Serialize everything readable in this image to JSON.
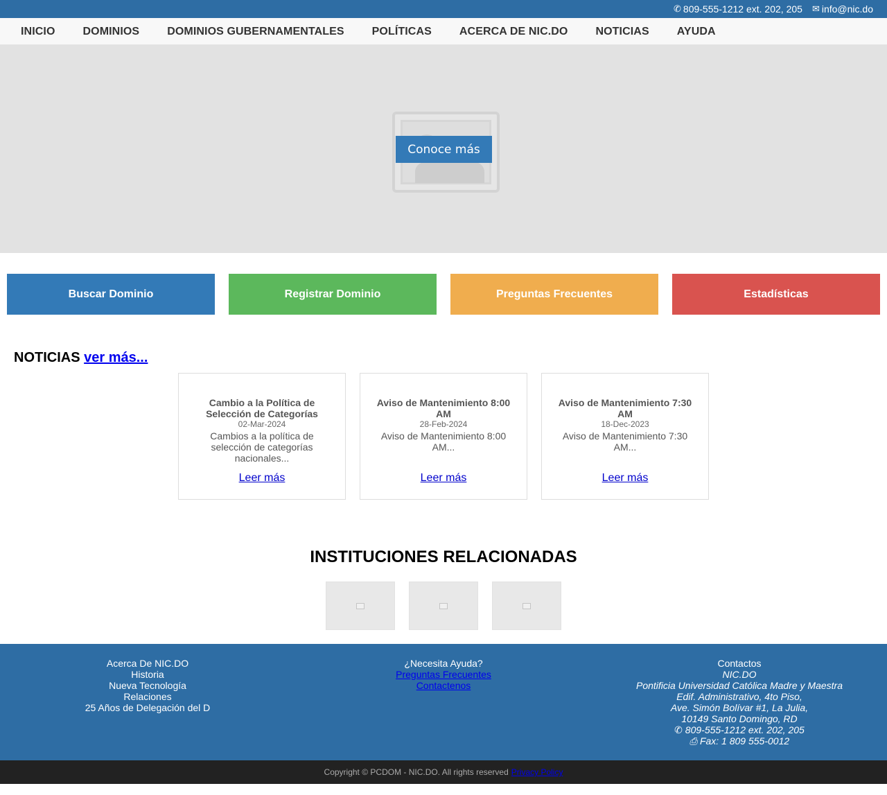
{
  "topbar": {
    "phone": "809-555-1212 ext. 202, 205",
    "email": "info@nic.do",
    "phone_icon": "phone-icon",
    "email_icon": "envelope-icon"
  },
  "nav": {
    "items": [
      "INICIO",
      "DOMINIOS",
      "DOMINIOS GUBERNAMENTALES",
      "POLÍTICAS",
      "ACERCA DE NIC.DO",
      "NOTICIAS",
      "AYUDA"
    ]
  },
  "hero": {
    "cta_label": "Conoce más",
    "image_icon": "image-placeholder-icon"
  },
  "tiles": [
    {
      "label": "Buscar Dominio",
      "color": "#337ab7"
    },
    {
      "label": "Registrar Dominio",
      "color": "#5cb85c"
    },
    {
      "label": "Preguntas Frecuentes",
      "color": "#f0ad4e"
    },
    {
      "label": "Estadísticas",
      "color": "#d9534f"
    }
  ],
  "news": {
    "heading": "NOTICIAS",
    "more_link": "ver más...",
    "cards": [
      {
        "title": "Cambio a la Política de Selección de Categorías",
        "date": "02-Mar-2024",
        "summary": "Cambios a la política de selección de categorías nacionales...",
        "link": "Leer más"
      },
      {
        "title": "Aviso de Mantenimiento 8:00 AM",
        "date": "28-Feb-2024",
        "summary": "Aviso de Mantenimiento 8:00 AM...",
        "link": "Leer más"
      },
      {
        "title": "Aviso de Mantenimiento 7:30 AM",
        "date": "18-Dec-2023",
        "summary": "Aviso de Mantenimiento 7:30 AM...",
        "link": "Leer más"
      }
    ]
  },
  "institutions": {
    "heading": "INSTITUCIONES RELACIONADAS"
  },
  "footer": {
    "about": [
      "Acerca De NIC.DO",
      "Historia",
      "Nueva Tecnología",
      "Relaciones",
      "25 Años de Delegación del D"
    ],
    "help_title": "¿Necesita Ayuda?",
    "help_links": [
      "Preguntas Frecuentes",
      "Contactenos"
    ],
    "contacts_title": "Contactos",
    "contacts_lines": [
      "NIC.DO",
      "Pontificia Universidad Católica Madre y Maestra",
      "Edif. Administrativo, 4to Piso,",
      "Ave. Simón Bolívar #1, La Julia,",
      "10149 Santo Domingo, RD",
      "809-555-1212 ext. 202, 205",
      "Fax: 1 809 555-0012"
    ]
  },
  "copyright": {
    "text": "Copyright © PCDOM - NIC.DO. All rights reserved",
    "privacy_link": "Privacy Policy"
  },
  "colors": {
    "brand_blue": "#2e6da4",
    "button_blue": "#337ab7",
    "footer_dark": "#222222"
  }
}
